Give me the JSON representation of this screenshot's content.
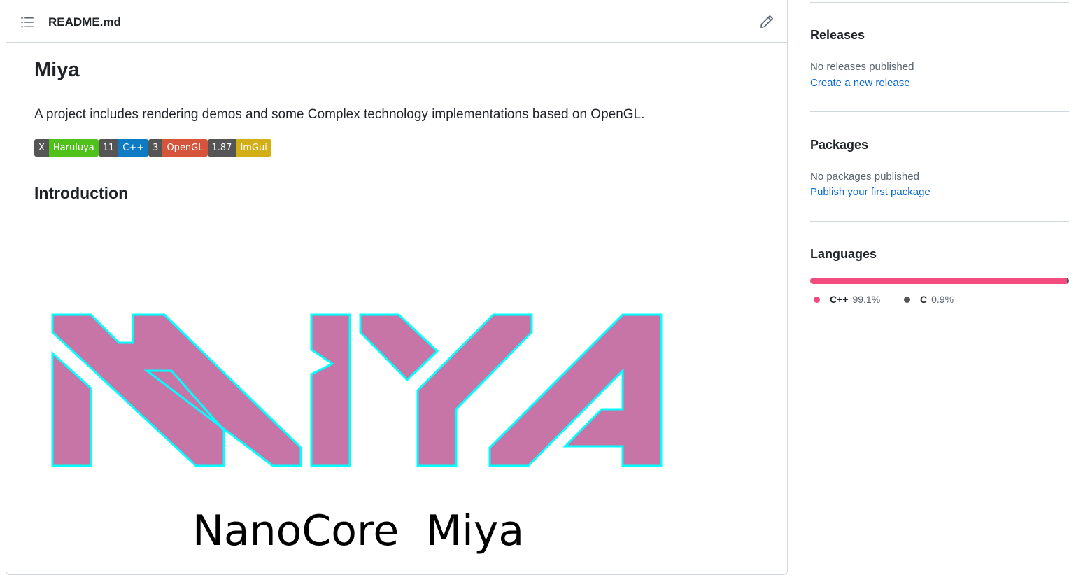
{
  "readme": {
    "filename": "README.md",
    "title": "Miya",
    "description": "A project includes rendering demos and some Complex technology implementations based on OpenGL.",
    "badges": [
      {
        "left": "X",
        "right": "Haruluya",
        "color": "#4fc11a"
      },
      {
        "left": "11",
        "right": "C++",
        "color": "#0d7ac3"
      },
      {
        "left": "3",
        "right": "OpenGL",
        "color": "#d4553c"
      },
      {
        "left": "1.87",
        "right": "ImGui",
        "color": "#d3af17"
      }
    ],
    "intro_heading": "Introduction",
    "logo_caption": "NanoCore  Miya",
    "logo_text": "MIYA"
  },
  "sidebar": {
    "releases": {
      "heading": "Releases",
      "status": "No releases published",
      "link": "Create a new release"
    },
    "packages": {
      "heading": "Packages",
      "status": "No packages published",
      "link": "Publish your first package"
    },
    "languages": {
      "heading": "Languages",
      "items": [
        {
          "name": "C++",
          "percent": "99.1%",
          "color": "#f34b7d"
        },
        {
          "name": "C",
          "percent": "0.9%",
          "color": "#555555"
        }
      ]
    }
  },
  "colors": {
    "logo_fill": "#c774a6",
    "logo_stroke": "#00ffff",
    "link": "#0969da"
  }
}
